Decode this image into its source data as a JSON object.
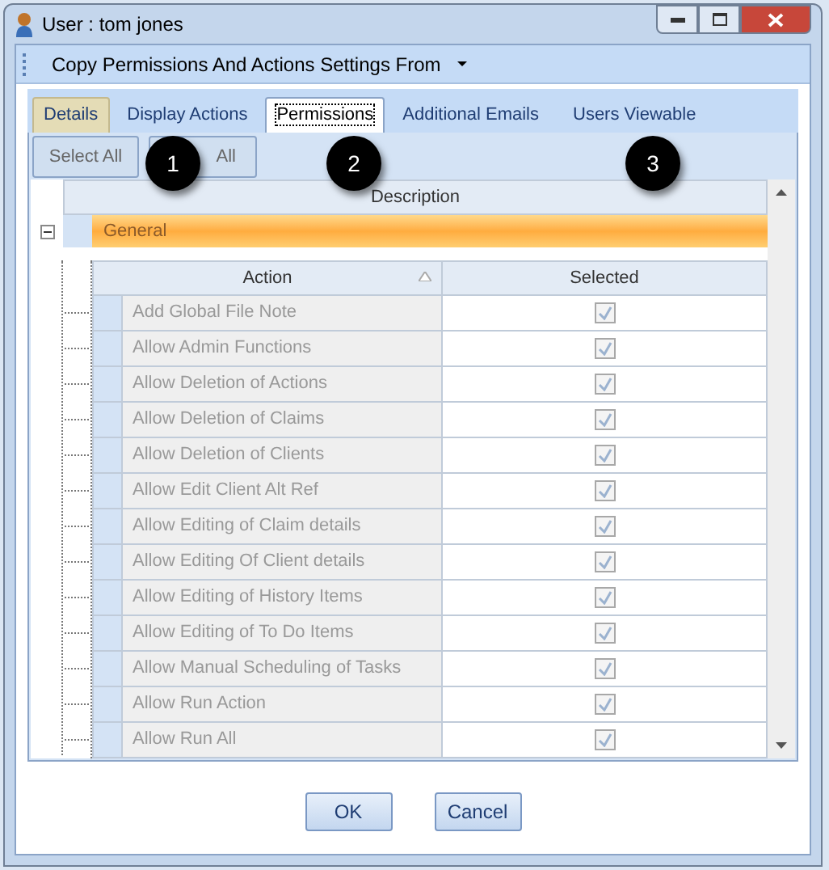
{
  "window": {
    "title": "User : tom jones"
  },
  "toolbar": {
    "menu": "Copy Permissions And Actions Settings From"
  },
  "tabs": [
    {
      "label": "Details",
      "selected": false,
      "kind": "tan"
    },
    {
      "label": "Display Actions",
      "selected": false,
      "kind": "plain"
    },
    {
      "label": "Permissions",
      "selected": true,
      "kind": "plain"
    },
    {
      "label": "Additional Emails",
      "selected": false,
      "kind": "plain"
    },
    {
      "label": "Users Viewable",
      "selected": false,
      "kind": "plain"
    }
  ],
  "buttons": [
    "Select All",
    "All"
  ],
  "callouts": [
    "1",
    "2",
    "3"
  ],
  "grid": {
    "column": "Description",
    "group": {
      "label": "General",
      "expanded": true
    },
    "columns": [
      "Action",
      "Selected"
    ],
    "rows": [
      {
        "action": "Add Global File Note",
        "checked": true
      },
      {
        "action": "Allow Admin Functions",
        "checked": true
      },
      {
        "action": "Allow Deletion of Actions",
        "checked": true
      },
      {
        "action": "Allow Deletion of Claims",
        "checked": true
      },
      {
        "action": "Allow Deletion of Clients",
        "checked": true
      },
      {
        "action": "Allow Edit Client Alt Ref",
        "checked": true
      },
      {
        "action": "Allow Editing of Claim details",
        "checked": true
      },
      {
        "action": "Allow Editing Of Client details",
        "checked": true
      },
      {
        "action": "Allow Editing of History Items",
        "checked": true
      },
      {
        "action": "Allow Editing of To Do Items",
        "checked": true
      },
      {
        "action": "Allow Manual Scheduling of Tasks",
        "checked": true
      },
      {
        "action": "Allow Run Action",
        "checked": true
      },
      {
        "action": "Allow Run All",
        "checked": true
      }
    ]
  },
  "footer": [
    "OK",
    "Cancel"
  ]
}
